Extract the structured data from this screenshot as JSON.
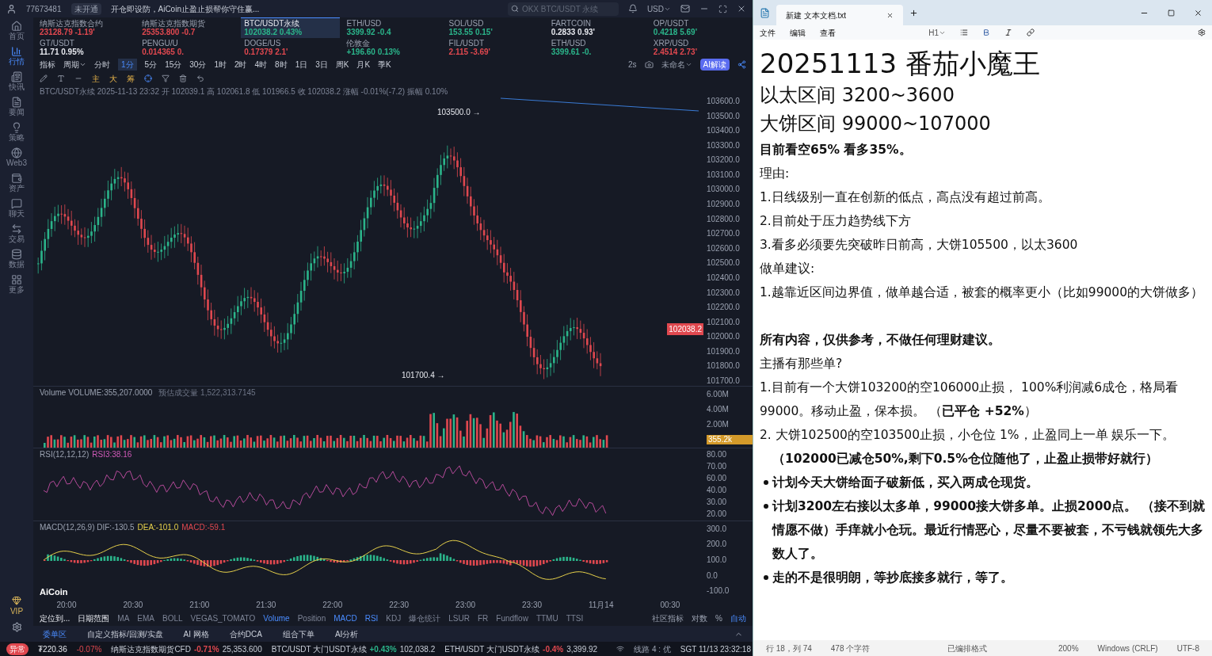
{
  "topbar": {
    "account": "77673481",
    "badge": "未开通",
    "notice": "开仓即设防，AiCoin止盈止损帮你守住赢...",
    "search_placeholder": "OKX BTC/USDT 永续",
    "currency": "USD"
  },
  "sidebar": {
    "items": [
      {
        "label": "首页",
        "selected": false
      },
      {
        "label": "行情",
        "selected": true
      },
      {
        "label": "快讯",
        "selected": false
      },
      {
        "label": "要闻",
        "selected": false
      },
      {
        "label": "策略",
        "selected": false
      },
      {
        "label": "Web3",
        "selected": false
      },
      {
        "label": "资产",
        "selected": false
      },
      {
        "label": "聊天",
        "selected": false
      },
      {
        "label": "交易",
        "selected": false
      },
      {
        "label": "数据",
        "selected": false
      },
      {
        "label": "更多",
        "selected": false
      }
    ],
    "vip": "VIP"
  },
  "tickers": [
    {
      "name": "纳斯达克指数合约",
      "value": "23128.79 -1.19'",
      "color": "#e0484f",
      "selected": false
    },
    {
      "name": "纳斯达克指数期货",
      "value": "25353.800 -0.7",
      "color": "#e0484f",
      "selected": false
    },
    {
      "name": "BTC/USDT永续",
      "value": "102038.2 0.43%",
      "color": "#2bb48a",
      "selected": true
    },
    {
      "name": "ETH/USD",
      "value": "3399.92 -0.4",
      "color": "#2bb48a",
      "selected": false
    },
    {
      "name": "SOL/USD",
      "value": "153.55 0.15'",
      "color": "#2bb48a",
      "selected": false
    },
    {
      "name": "FARTCOIN",
      "value": "0.2833 0.93'",
      "color": "#e6e8ee",
      "selected": false
    },
    {
      "name": "OP/USDT",
      "value": "0.4218 5.69'",
      "color": "#2bb48a",
      "selected": false
    },
    {
      "name": "GT/USDT",
      "value": "11.71 0.95%",
      "color": "#e6e8ee",
      "selected": false
    },
    {
      "name": "PENGU/U",
      "value": "0.014365 0.",
      "color": "#e0484f",
      "selected": false
    },
    {
      "name": "DOGE/US",
      "value": "0.17379 2.1'",
      "color": "#e0484f",
      "selected": false
    },
    {
      "name": "伦敦金",
      "value": "+196.60 0.13%",
      "color": "#2bb48a",
      "selected": false
    },
    {
      "name": "FIL/USDT",
      "value": "2.115 -3.69'",
      "color": "#e0484f",
      "selected": false
    },
    {
      "name": "ETH/USD",
      "value": "3399.61 -0.",
      "color": "#2bb48a",
      "selected": false
    },
    {
      "name": "XRP/USD",
      "value": "2.4514 2.73'",
      "color": "#e0484f",
      "selected": false
    }
  ],
  "toolbar": {
    "indicator": "指标",
    "period": "周期",
    "periods": [
      {
        "label": "分时",
        "selected": false
      },
      {
        "label": "1分",
        "selected": true
      },
      {
        "label": "5分",
        "selected": false
      },
      {
        "label": "15分",
        "selected": false
      },
      {
        "label": "30分",
        "selected": false
      },
      {
        "label": "1时",
        "selected": false
      },
      {
        "label": "2时",
        "selected": false
      },
      {
        "label": "4时",
        "selected": false
      },
      {
        "label": "8时",
        "selected": false
      },
      {
        "label": "1日",
        "selected": false
      },
      {
        "label": "3日",
        "selected": false
      },
      {
        "label": "周K",
        "selected": false
      },
      {
        "label": "月K",
        "selected": false
      },
      {
        "label": "季K",
        "selected": false
      }
    ],
    "refresh": "2s",
    "layout": "未命名",
    "ai": "AI解读",
    "marks": [
      "主",
      "大",
      "筹"
    ]
  },
  "chart": {
    "info": "BTC/USDT永续 2025-11-13 23:32 开 102039.1 高 102061.8 低 101966.5 收 102038.2 涨幅 -0.01%(-7.2) 振幅 0.10%",
    "price_ticks": [
      "103600.0",
      "103500.0",
      "103400.0",
      "103300.0",
      "103200.0",
      "103100.0",
      "103000.0",
      "102900.0",
      "102800.0",
      "102700.0",
      "102600.0",
      "102500.0",
      "102400.0",
      "102300.0",
      "102200.0",
      "102100.0",
      "102000.0",
      "101900.0",
      "101800.0",
      "101700.0"
    ],
    "high_label": "103500.0 →",
    "low_label": "101700.4 →",
    "last_price": "102038.2",
    "volume": {
      "legend": "Volume VOLUME:355,207.0000",
      "estimate": "预估成交量 1,522,313.7145",
      "ticks": [
        "6.00M",
        "4.00M",
        "2.00M"
      ],
      "last": "355.2k"
    },
    "rsi": {
      "legend": "RSI(12,12,12)",
      "value": "RSI3:38.16",
      "ticks": [
        "80.00",
        "70.00",
        "60.00",
        "40.00",
        "30.00",
        "20.00"
      ]
    },
    "macd": {
      "legend": "MACD(12,26,9) DIF:-130.5",
      "dea": "DEA:-101.0",
      "macd": "MACD:-59.1",
      "ticks": [
        "300.0",
        "200.0",
        "100.0",
        "0.0",
        "-100.0"
      ]
    },
    "logo": "AiCoin",
    "times": [
      "20:00",
      "20:30",
      "21:00",
      "21:30",
      "22:00",
      "22:30",
      "23:00",
      "23:30",
      "11月14",
      "00:30"
    ]
  },
  "indicator_bar": {
    "locate": "定位到...",
    "range": "日期范围",
    "items": [
      {
        "label": "MA",
        "selected": false
      },
      {
        "label": "EMA",
        "selected": false
      },
      {
        "label": "BOLL",
        "selected": false
      },
      {
        "label": "VEGAS_TOMATO",
        "selected": false
      },
      {
        "label": "Volume",
        "selected": true
      },
      {
        "label": "Position",
        "selected": false
      },
      {
        "label": "MACD",
        "selected": true
      },
      {
        "label": "RSI",
        "selected": true
      },
      {
        "label": "KDJ",
        "selected": false
      },
      {
        "label": "爆仓统计",
        "selected": false
      },
      {
        "label": "LSUR",
        "selected": false
      },
      {
        "label": "FR",
        "selected": false
      },
      {
        "label": "Fundflow",
        "selected": false
      },
      {
        "label": "TTMU",
        "selected": false
      },
      {
        "label": "TTSI",
        "selected": false
      }
    ],
    "community": "社区指标",
    "log": "对数",
    "percent": "%",
    "auto": "自动"
  },
  "bottom_tabs": [
    {
      "label": "委单区",
      "selected": true
    },
    {
      "label": "自定义指标/回测/实盘",
      "selected": false
    },
    {
      "label": "AI 网格",
      "selected": false
    },
    {
      "label": "合约DCA",
      "selected": false
    },
    {
      "label": "组合下单",
      "selected": false
    },
    {
      "label": "AI分析",
      "selected": false
    }
  ],
  "status_bar": {
    "alert": "异常",
    "balance": "₮220.36",
    "balance_change": "-0.07%",
    "quotes": [
      {
        "name": "纳斯达克指数期货CFD",
        "change": "-0.71%",
        "price": "25,353.600",
        "color": "#e0484f"
      },
      {
        "name": "BTC/USDT 大门USDT永续",
        "change": "+0.43%",
        "price": "102,038.2",
        "color": "#2bb48a"
      },
      {
        "name": "ETH/USDT 大门USDT永续",
        "change": "-0.4%",
        "price": "3,399.92",
        "color": "#e0484f"
      }
    ],
    "line": "线路 4 : 优",
    "clock": "SGT 11/13 23:32:18"
  },
  "notepad": {
    "tab": "新建 文本文档.txt",
    "menu": [
      "文件",
      "编辑",
      "查看"
    ],
    "heading_select": "H1",
    "lines": [
      {
        "kind": "h1",
        "text": "20251113 番茄小魔王"
      },
      {
        "kind": "h2",
        "text": "以太区间 3200~3600"
      },
      {
        "kind": "h2",
        "text": "大饼区间 99000~107000"
      },
      {
        "kind": "bold",
        "text": "目前看空65% 看多35%。"
      },
      {
        "kind": "p",
        "text": "理由:"
      },
      {
        "kind": "p",
        "text": "1.日线级别一直在创新的低点，高点没有超过前高。"
      },
      {
        "kind": "p",
        "text": "2.目前处于压力趋势线下方"
      },
      {
        "kind": "p",
        "text": "3.看多必须要先突破昨日前高，大饼105500，以太3600"
      },
      {
        "kind": "p",
        "text": "做单建议:"
      },
      {
        "kind": "p",
        "text": "1.越靠近区间边界值，做单越合适，被套的概率更小（比如99000的大饼做多）"
      },
      {
        "kind": "blank"
      },
      {
        "kind": "bold",
        "text": "所有内容，仅供参考，不做任何理财建议。"
      },
      {
        "kind": "p",
        "text": "主播有那些单?"
      },
      {
        "kind": "p",
        "text": "1.目前有一个大饼103200的空106000止损， 100%利润减6成仓，格局看99000。移动止盈，保本损。 （**已平仓 +52%**）"
      },
      {
        "kind": "p",
        "text": "2. 大饼102500的空103500止损，小仓位 1%，止盈同上一单 娱乐一下。"
      },
      {
        "kind": "indent",
        "text": "（102000已减仓50%,剩下0.5%仓位随他了，止盈止损带好就行）"
      },
      {
        "kind": "bullet",
        "text": "计划今天大饼给面子破新低，买入两成仓现货。"
      },
      {
        "kind": "bullet",
        "text": "计划3200左右接以太多单，99000接大饼多单。止损2000点。 （接不到就情愿不做）手痒就小仓玩。最近行情恶心，尽量不要被套，不亏钱就领先大多数人了。"
      },
      {
        "kind": "bullet",
        "text": "走的不是很明朗，等抄底接多就行，等了。"
      }
    ],
    "status": {
      "position": "行 18，列 74",
      "chars": "478 个字符",
      "format": "已编排格式",
      "zoom": "200%",
      "eol": "Windows (CRLF)",
      "encoding": "UTF-8"
    }
  }
}
